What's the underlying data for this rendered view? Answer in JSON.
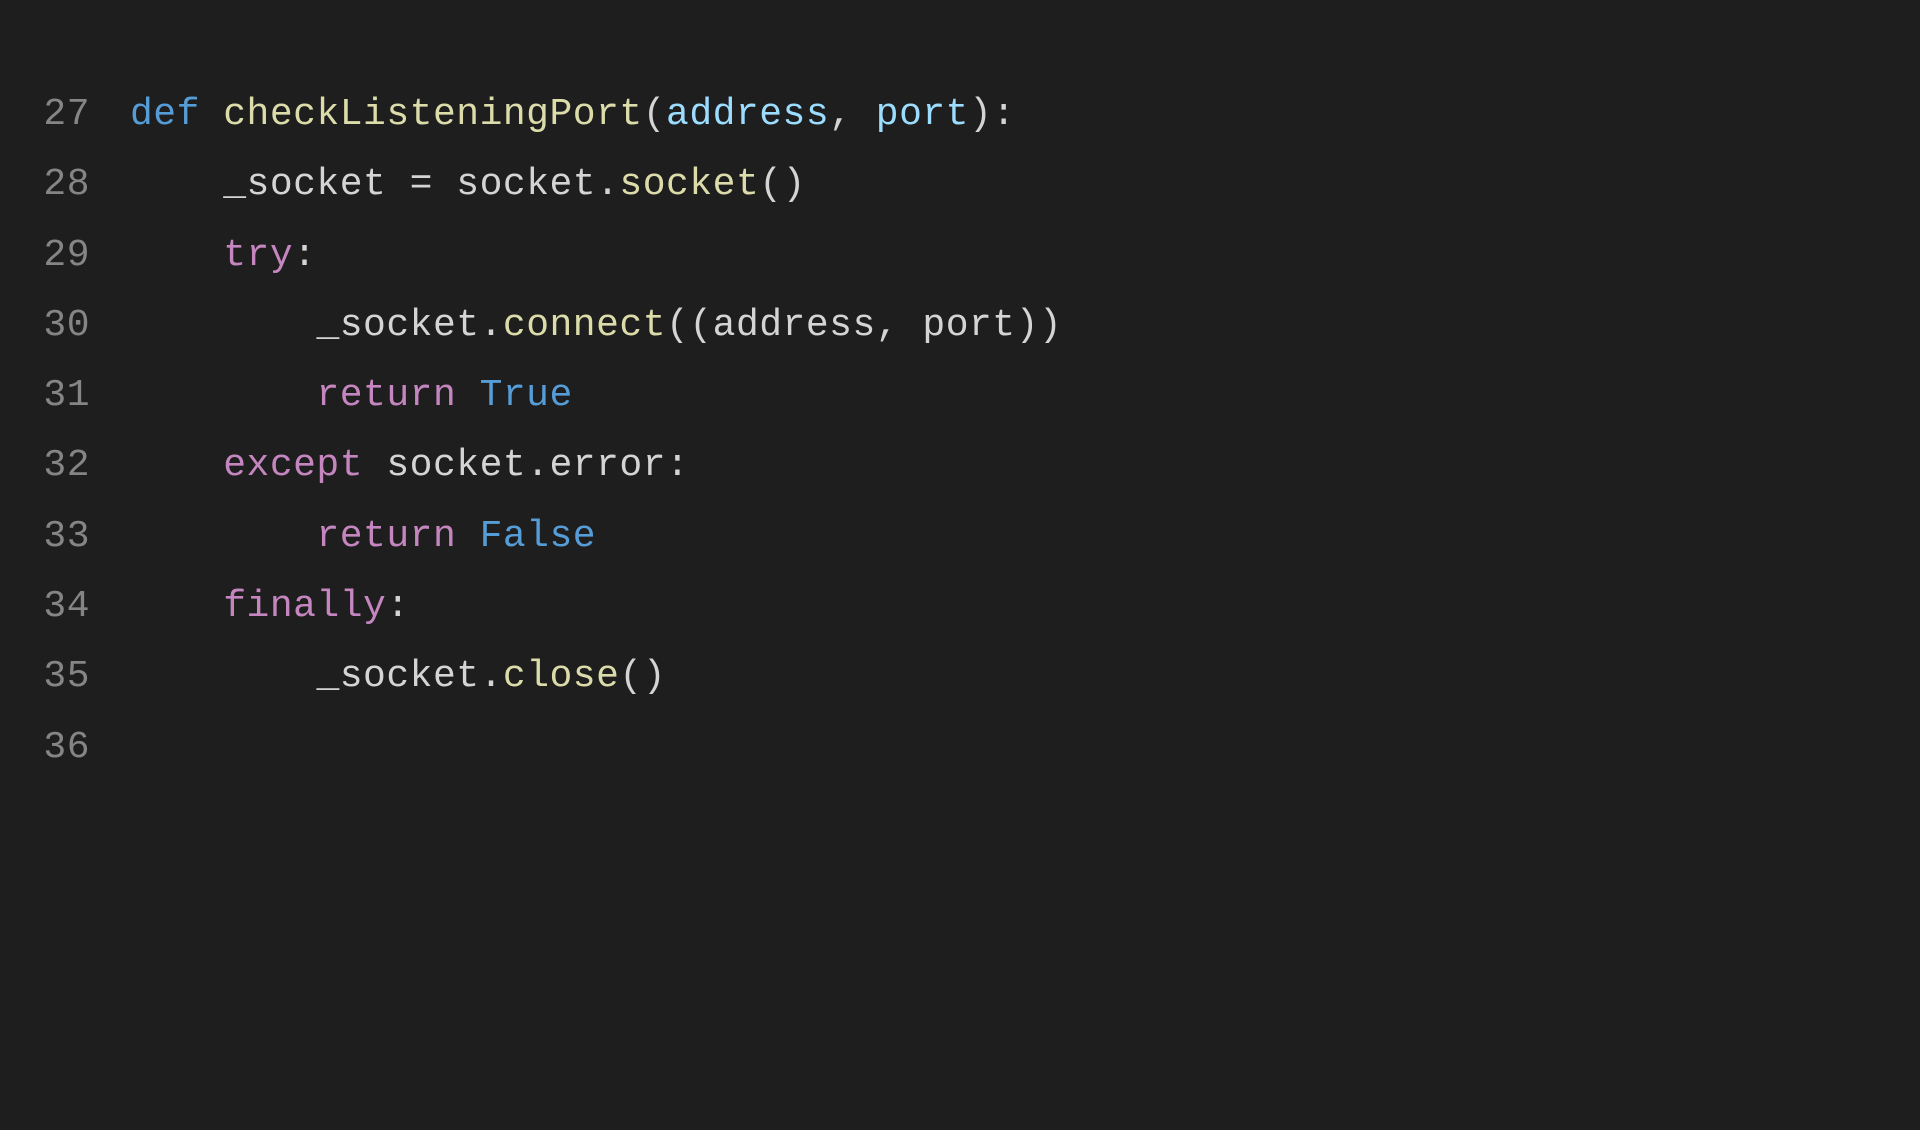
{
  "lines": [
    {
      "num": "27"
    },
    {
      "num": "28"
    },
    {
      "num": "29"
    },
    {
      "num": "30"
    },
    {
      "num": "31"
    },
    {
      "num": "32"
    },
    {
      "num": "33"
    },
    {
      "num": "34"
    },
    {
      "num": "35"
    },
    {
      "num": "36"
    }
  ],
  "code": {
    "l27": {
      "def": "def",
      "space1": " ",
      "fname": "checkListeningPort",
      "lparen": "(",
      "p1": "address",
      "comma": ", ",
      "p2": "port",
      "rparen": ")",
      "colon": ":"
    },
    "l28": {
      "indent": "    ",
      "var": "_socket",
      "eq": " = ",
      "mod": "socket",
      "dot": ".",
      "call": "socket",
      "parens": "()"
    },
    "l29": {
      "indent": "    ",
      "try": "try",
      "colon": ":"
    },
    "l30": {
      "indent": "        ",
      "var": "_socket",
      "dot": ".",
      "method": "connect",
      "lparen": "((",
      "p1": "address",
      "comma": ", ",
      "p2": "port",
      "rparen": "))"
    },
    "l31": {
      "indent": "        ",
      "ret": "return",
      "space": " ",
      "val": "True"
    },
    "l32": {
      "indent": "    ",
      "exc": "except",
      "space": " ",
      "mod": "socket",
      "dot": ".",
      "err": "error",
      "colon": ":"
    },
    "l33": {
      "indent": "        ",
      "ret": "return",
      "space": " ",
      "val": "False"
    },
    "l34": {
      "indent": "    ",
      "fin": "finally",
      "colon": ":"
    },
    "l35": {
      "indent": "        ",
      "var": "_socket",
      "dot": ".",
      "method": "close",
      "parens": "()"
    },
    "l36": {
      "indent": ""
    }
  }
}
